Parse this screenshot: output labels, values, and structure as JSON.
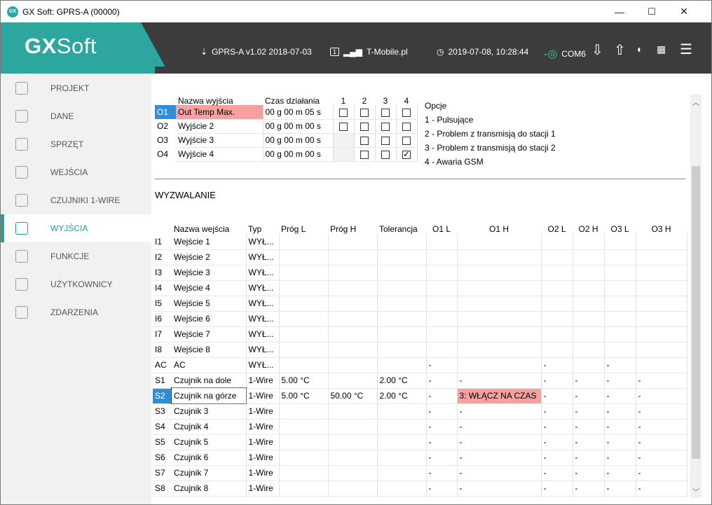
{
  "window": {
    "title": "GX Soft: GPRS-A (00000)",
    "min": "—",
    "max": "☐",
    "close": "✕",
    "app_icon_text": "GX"
  },
  "header": {
    "logo_bold": "GX",
    "logo_light": "Soft",
    "device": "GPRS-A v1.02 2018-07-03",
    "sim": "1",
    "operator": "T-Mobile.pl",
    "datetime": "2019-07-08, 10:28:44",
    "com": "COM6"
  },
  "sidebar": {
    "items": [
      {
        "label": "PROJEKT",
        "icon": "globe-icon"
      },
      {
        "label": "DANE",
        "icon": "database-icon"
      },
      {
        "label": "SPRZĘT",
        "icon": "chip-icon"
      },
      {
        "label": "WEJŚCIA",
        "icon": "input-icon"
      },
      {
        "label": "CZUJNIKI 1-WIRE",
        "icon": "sensor-icon"
      },
      {
        "label": "WYJŚCIA",
        "icon": "output-icon",
        "active": true
      },
      {
        "label": "FUNKCJE",
        "icon": "gear-icon"
      },
      {
        "label": "UŻYTKOWNICY",
        "icon": "user-icon"
      },
      {
        "label": "ZDARZENIA",
        "icon": "document-icon"
      }
    ]
  },
  "outputs": {
    "headers": [
      "",
      "Nazwa wyjścia",
      "Czas działania",
      "1",
      "2",
      "3",
      "4"
    ],
    "rows": [
      {
        "id": "O1",
        "name": "Out Temp Max.",
        "time": "00 g 00 m 05 s",
        "c": [
          false,
          false,
          false,
          false
        ],
        "selected": true
      },
      {
        "id": "O2",
        "name": "Wyjście 2",
        "time": "00 g 00 m 00 s",
        "c": [
          false,
          false,
          false,
          false
        ]
      },
      {
        "id": "O3",
        "name": "Wyjście 3",
        "time": "00 g 00 m 00 s",
        "c": [
          null,
          false,
          false,
          false
        ]
      },
      {
        "id": "O4",
        "name": "Wyjście 4",
        "time": "00 g 00 m 00 s",
        "c": [
          null,
          false,
          false,
          true
        ]
      }
    ]
  },
  "options": {
    "title": "Opcje",
    "items": [
      "1 - Pulsujące",
      "2 - Problem z transmisją do stacji 1",
      "3 - Problem z transmisją do stacji 2",
      "4 - Awaria GSM"
    ]
  },
  "triggers": {
    "title": "WYZWALANIE",
    "headers": [
      "",
      "Nazwa wejścia",
      "Typ",
      "Próg L",
      "Próg H",
      "Tolerancja",
      "O1 L",
      "O1 H",
      "O2 L",
      "O2 H",
      "O3 L",
      "O3 H"
    ],
    "rows": [
      [
        "I1",
        "Wejście 1",
        "WYŁ...",
        "",
        "",
        "",
        "",
        "",
        "",
        "",
        "",
        ""
      ],
      [
        "I2",
        "Wejście 2",
        "WYŁ...",
        "",
        "",
        "",
        "",
        "",
        "",
        "",
        "",
        ""
      ],
      [
        "I3",
        "Wejście 3",
        "WYŁ...",
        "",
        "",
        "",
        "",
        "",
        "",
        "",
        "",
        ""
      ],
      [
        "I4",
        "Wejście 4",
        "WYŁ...",
        "",
        "",
        "",
        "",
        "",
        "",
        "",
        "",
        ""
      ],
      [
        "I5",
        "Wejście 5",
        "WYŁ...",
        "",
        "",
        "",
        "",
        "",
        "",
        "",
        "",
        ""
      ],
      [
        "I6",
        "Wejście 6",
        "WYŁ...",
        "",
        "",
        "",
        "",
        "",
        "",
        "",
        "",
        ""
      ],
      [
        "I7",
        "Wejście 7",
        "WYŁ...",
        "",
        "",
        "",
        "",
        "",
        "",
        "",
        "",
        ""
      ],
      [
        "I8",
        "Wejście 8",
        "WYŁ...",
        "",
        "",
        "",
        "",
        "",
        "",
        "",
        "",
        ""
      ],
      [
        "AC",
        "AC",
        "WYŁ...",
        "",
        "",
        "",
        "-",
        "",
        "-",
        "",
        "-",
        ""
      ],
      [
        "S1",
        "Czujnik na dole",
        "1-Wire",
        "5.00 °C",
        "",
        "2.00 °C",
        "-",
        "-",
        "-",
        "-",
        "-",
        "-"
      ],
      [
        "S2",
        "Czujnik na górze",
        "1-Wire",
        "5.00 °C",
        "50.00 °C",
        "2.00 °C",
        "-",
        "3: WŁĄCZ NA CZAS",
        "-",
        "-",
        "-",
        "-"
      ],
      [
        "S3",
        "Czujnik 3",
        "1-Wire",
        "",
        "",
        "",
        "-",
        "-",
        "-",
        "-",
        "-",
        "-"
      ],
      [
        "S4",
        "Czujnik 4",
        "1-Wire",
        "",
        "",
        "",
        "-",
        "-",
        "-",
        "-",
        "-",
        "-"
      ],
      [
        "S5",
        "Czujnik 5",
        "1-Wire",
        "",
        "",
        "",
        "-",
        "-",
        "-",
        "-",
        "-",
        "-"
      ],
      [
        "S6",
        "Czujnik 6",
        "1-Wire",
        "",
        "",
        "",
        "-",
        "-",
        "-",
        "-",
        "-",
        "-"
      ],
      [
        "S7",
        "Czujnik 7",
        "1-Wire",
        "",
        "",
        "",
        "-",
        "-",
        "-",
        "-",
        "-",
        "-"
      ],
      [
        "S8",
        "Czujnik 8",
        "1-Wire",
        "",
        "",
        "",
        "-",
        "-",
        "-",
        "-",
        "-",
        "-"
      ]
    ],
    "selected_row": "S2",
    "highlight_cell_text": "3: WŁĄCZ NA CZAS"
  },
  "colors": {
    "accent": "#2ea6a0",
    "header_bg": "#3c3c3c",
    "selection": "#2e8fd8",
    "highlight": "#f6a0a0"
  }
}
